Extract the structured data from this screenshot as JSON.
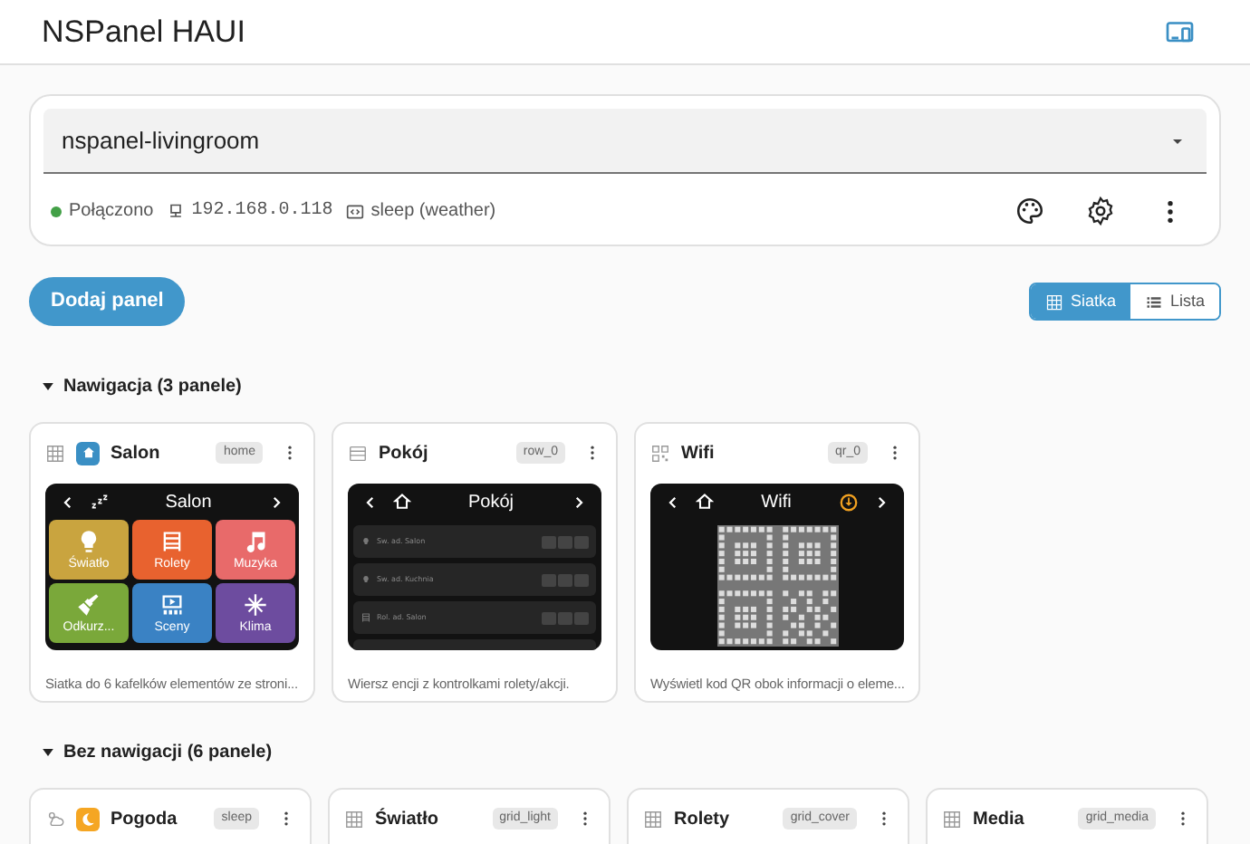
{
  "app_title": "NSPanel HAUI",
  "device": {
    "selected_value": "nspanel-livingroom",
    "status": "Połączono",
    "connected": true,
    "ip": "192.168.0.118",
    "mode": "sleep (weather)"
  },
  "add_button": "Dodaj panel",
  "view_toggle": [
    {
      "label": "Siatka",
      "kind": "grid",
      "selected": true
    },
    {
      "label": "Lista",
      "kind": "list",
      "selected": false
    }
  ],
  "sections": [
    {
      "title": "Nawigacja (3 panele)",
      "expanded": true,
      "panels": [
        {
          "kind": "grid",
          "name": "Salon",
          "badge": "home",
          "home": true,
          "preview_title": "Salon",
          "description": "Siatka do 6 kafelków elementów ze stroni...",
          "tiles": [
            {
              "label": "Światło",
              "color": "#c9a43f"
            },
            {
              "label": "Rolety",
              "color": "#e8622f"
            },
            {
              "label": "Muzyka",
              "color": "#e86a6a"
            },
            {
              "label": "Odkurz...",
              "color": "#7aa83a"
            },
            {
              "label": "Sceny",
              "color": "#3a82c4"
            },
            {
              "label": "Klima",
              "color": "#6d4c9f"
            }
          ]
        },
        {
          "kind": "rows",
          "name": "Pokój",
          "badge": "row_0",
          "preview_title": "Pokój",
          "description": "Wiersz encji z kontrolkami rolety/akcji.",
          "rows": [
            {
              "label": "Sw. ad. Salon"
            },
            {
              "label": "Sw. ad. Kuchnia"
            },
            {
              "label": "Rol. ad. Salon"
            }
          ]
        },
        {
          "kind": "qr",
          "name": "Wifi",
          "badge": "qr_0",
          "preview_title": "Wifi",
          "description": "Wyświetl kod QR obok informacji o eleme..."
        }
      ]
    },
    {
      "title": "Bez nawigacji (6 panele)",
      "expanded": true,
      "panels": [
        {
          "kind": "sleep",
          "name": "Pogoda",
          "badge": "sleep",
          "sleep": true
        },
        {
          "kind": "grid",
          "name": "Światło",
          "badge": "grid_light"
        },
        {
          "kind": "grid",
          "name": "Rolety",
          "badge": "grid_cover"
        },
        {
          "kind": "grid",
          "name": "Media",
          "badge": "grid_media"
        }
      ]
    }
  ]
}
